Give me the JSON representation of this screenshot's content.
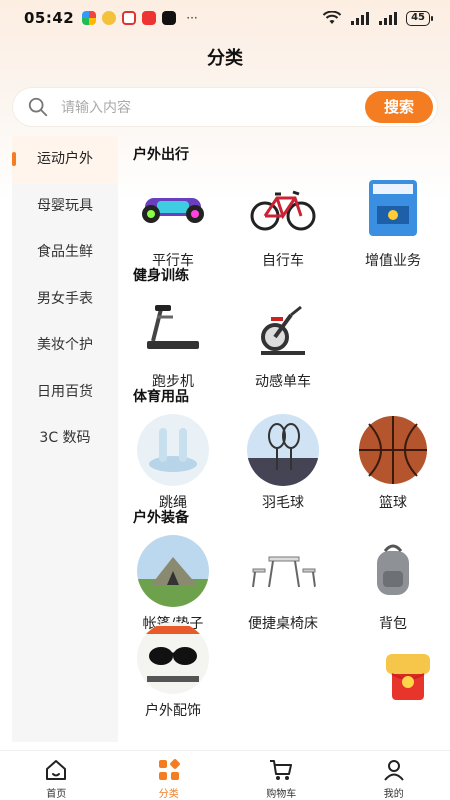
{
  "status_bar": {
    "time": "05:42",
    "more": "···",
    "network_label": "6",
    "battery": "45"
  },
  "header": {
    "title": "分类"
  },
  "search": {
    "placeholder": "请输入内容",
    "button_label": "搜索"
  },
  "sidebar": {
    "items": [
      {
        "label": "运动户外",
        "active": true
      },
      {
        "label": "母婴玩具"
      },
      {
        "label": "食品生鲜"
      },
      {
        "label": "男女手表"
      },
      {
        "label": "美妆个护"
      },
      {
        "label": "日用百货"
      },
      {
        "label": "3C 数码"
      }
    ]
  },
  "sections": [
    {
      "title": "户外出行",
      "items": [
        {
          "label": "平行车"
        },
        {
          "label": "自行车"
        },
        {
          "label": "增值业务"
        }
      ]
    },
    {
      "title": "健身训练",
      "items": [
        {
          "label": "跑步机"
        },
        {
          "label": "动感单车"
        }
      ]
    },
    {
      "title": "体育用品",
      "items": [
        {
          "label": "跳绳"
        },
        {
          "label": "羽毛球"
        },
        {
          "label": "篮球"
        }
      ]
    },
    {
      "title": "户外装备",
      "items": [
        {
          "label": "帐篷/垫子"
        },
        {
          "label": "便捷桌椅床"
        },
        {
          "label": "背包"
        },
        {
          "label": "户外配饰"
        }
      ]
    }
  ],
  "bottom_nav": {
    "items": [
      {
        "label": "首页",
        "icon": "home-icon"
      },
      {
        "label": "分类",
        "icon": "category-icon",
        "active": true
      },
      {
        "label": "购物车",
        "icon": "cart-icon"
      },
      {
        "label": "我的",
        "icon": "profile-icon"
      }
    ]
  },
  "colors": {
    "accent": "#f47d22",
    "sidebar_bg": "#f6f6f6",
    "active_bg": "#fff5ed"
  }
}
